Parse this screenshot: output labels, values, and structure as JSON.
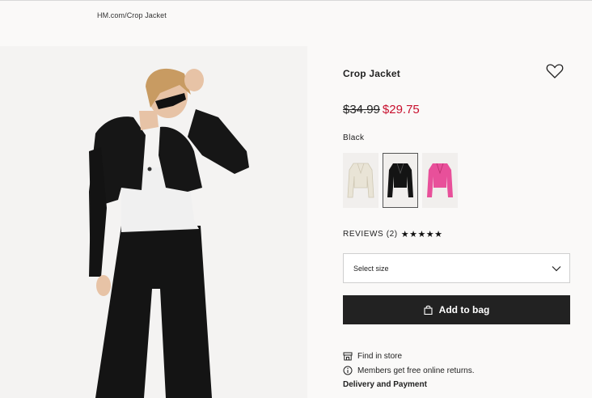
{
  "breadcrumb": {
    "text": "HM.com/Crop Jacket"
  },
  "product": {
    "title": "Crop Jacket",
    "old_price": "$34.99",
    "new_price": "$29.75",
    "color_label": "Black",
    "colors": [
      "#e9e4d6",
      "#141414",
      "#e8509a"
    ],
    "selected_swatch_index": 1
  },
  "reviews": {
    "label": "REVIEWS (2)",
    "stars": "★★★★★"
  },
  "size_select": {
    "placeholder": "Select size"
  },
  "add_to_bag": {
    "label": "Add to bag"
  },
  "links": {
    "find_in_store": "Find in store",
    "returns": "Members get free online returns.",
    "delivery": "Delivery and Payment"
  },
  "colors": {
    "price_sale": "#c8102e",
    "button_bg": "#222222"
  }
}
